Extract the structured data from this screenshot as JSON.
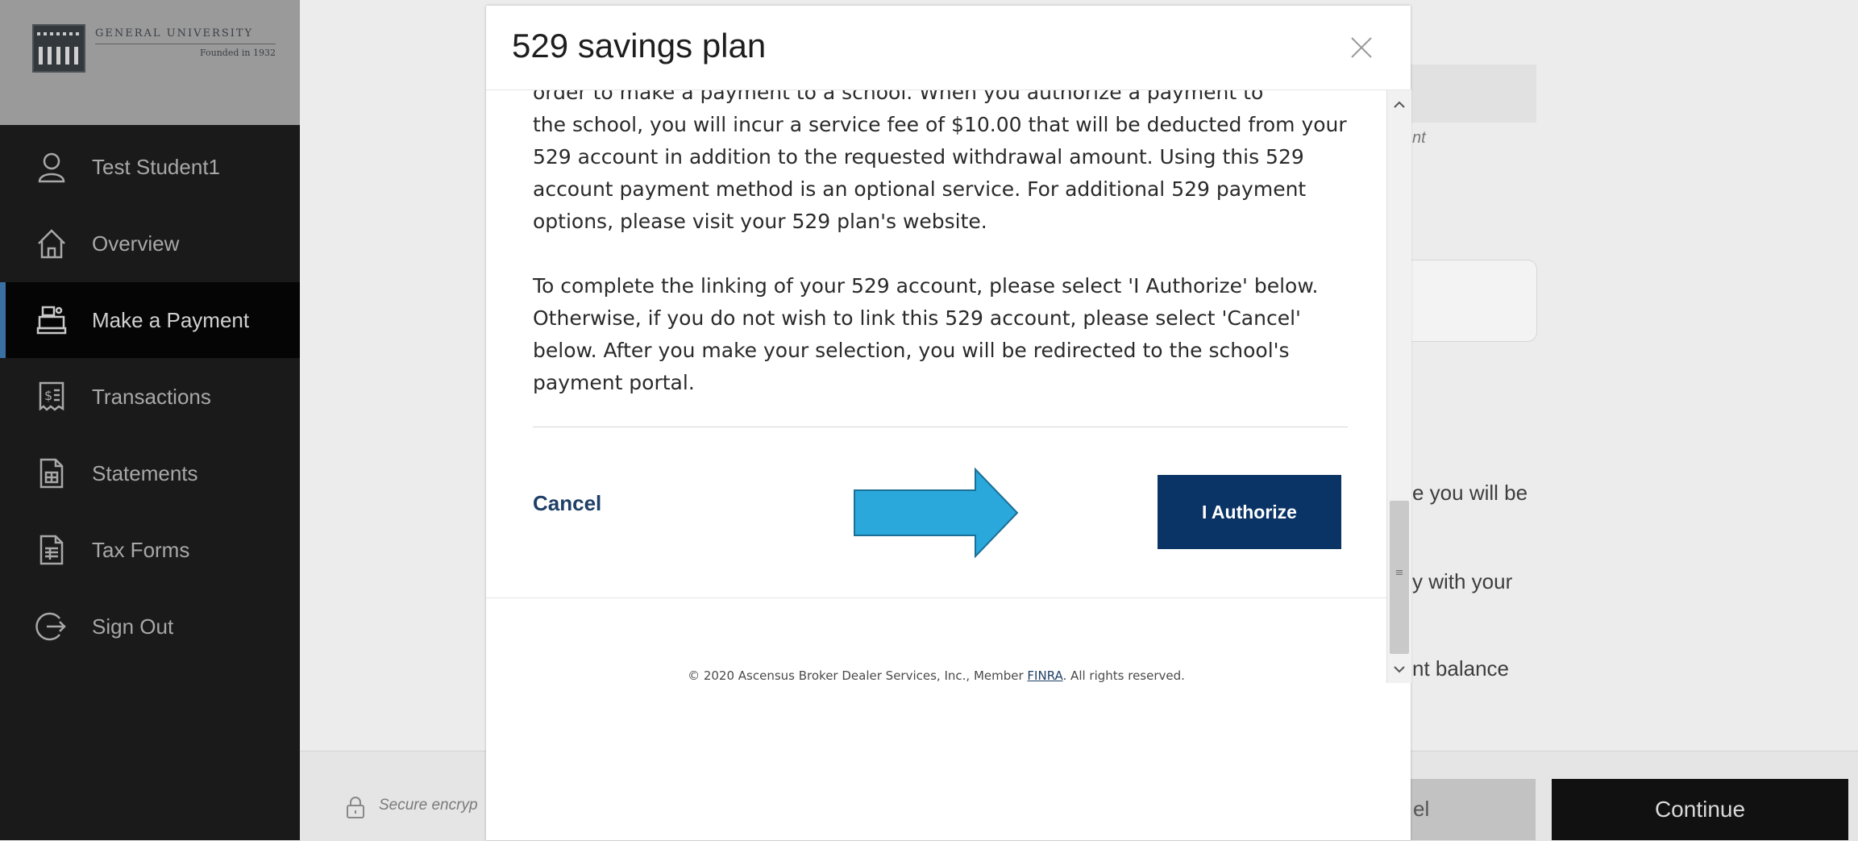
{
  "brand": {
    "name": "GENERAL UNIVERSITY",
    "tagline": "Founded in 1932"
  },
  "sidebar": {
    "items": [
      {
        "label": "Test Student1",
        "icon": "user-icon"
      },
      {
        "label": "Overview",
        "icon": "home-icon"
      },
      {
        "label": "Make a Payment",
        "icon": "register-icon",
        "active": true
      },
      {
        "label": "Transactions",
        "icon": "receipt-icon"
      },
      {
        "label": "Statements",
        "icon": "statement-icon"
      },
      {
        "label": "Tax Forms",
        "icon": "tax-form-icon"
      },
      {
        "label": "Sign Out",
        "icon": "sign-out-icon"
      }
    ]
  },
  "background": {
    "partial_text_1": "nt",
    "partial_text_2": "e you will be",
    "partial_text_3": "y with your",
    "partial_text_4": "nt balance",
    "secure_text": "Secure encryp",
    "cancel_partial": "el",
    "continue_label": "Continue"
  },
  "modal": {
    "title": "529 savings plan",
    "paragraph_cut": "order to make a payment to a school. When you authorize a payment to",
    "paragraph_1": "the school, you will incur a service fee of $10.00 that will be deducted from your 529 account in addition to the requested withdrawal amount. Using this 529 account payment method is an optional service. For additional 529 payment options, please visit your 529 plan's website.",
    "paragraph_2": "To complete the linking of your 529 account, please select 'I Authorize' below. Otherwise, if you do not wish to link this 529 account, please select 'Cancel' below. After you make your selection, you will be redirected to the school's payment portal.",
    "cancel_label": "Cancel",
    "authorize_label": "I Authorize",
    "copyright_prefix": "© 2020 Ascensus Broker Dealer Services, Inc., Member ",
    "copyright_link": "FINRA",
    "copyright_suffix": ". All rights reserved."
  },
  "colors": {
    "sidebar_bg": "#1a1a1a",
    "primary_button": "#0a3466",
    "arrow": "#2aa8dc",
    "link": "#1f3f66"
  }
}
